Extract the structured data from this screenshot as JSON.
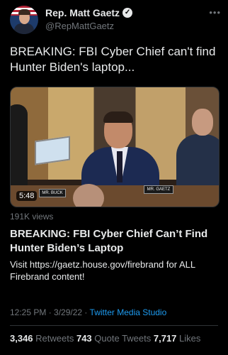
{
  "author": {
    "name": "Rep. Matt Gaetz",
    "handle": "@RepMattGaetz",
    "verified_glyph": "✓"
  },
  "more_glyph": "•••",
  "tweet_text": "BREAKING: FBI Cyber Chief can't find Hunter Biden's laptop...",
  "media": {
    "duration": "5:48",
    "nameplate_left": "MR. BUCK",
    "nameplate_right": "MR. GAETZ"
  },
  "video": {
    "views": "191K views",
    "title": "BREAKING: FBI Cyber Chief Can’t Find Hunter Biden’s Laptop",
    "description": "Visit https://gaetz.house.gov/firebrand for ALL Firebrand content!"
  },
  "meta": {
    "time": "12:25 PM",
    "sep1": " · ",
    "date": "3/29/22",
    "sep2": " · ",
    "source": "Twitter Media Studio"
  },
  "stats": {
    "retweets_count": "3,346",
    "retweets_label": " Retweets ",
    "quotes_count": "743",
    "quotes_label": " Quote Tweets ",
    "likes_count": "7,717",
    "likes_label": " Likes"
  },
  "colors": {
    "background": "#000000",
    "text": "#e7e9ea",
    "secondary": "#71767b",
    "link": "#1d9bf0"
  }
}
